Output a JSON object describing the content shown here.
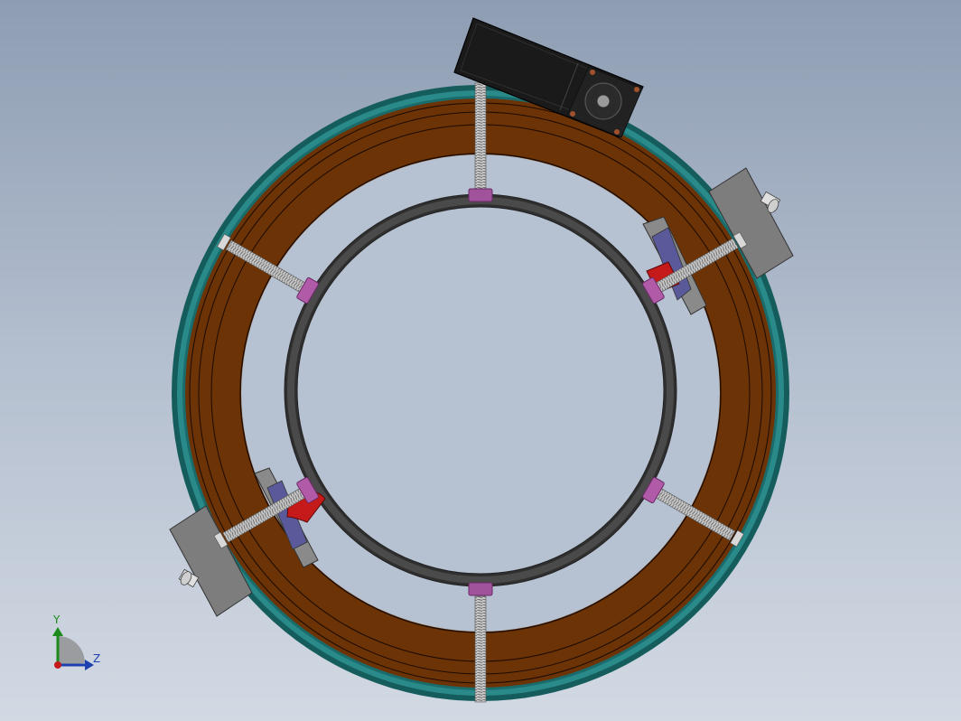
{
  "view": {
    "background_top": "#8e9db3",
    "background_bottom": "#d2d9e3"
  },
  "model": {
    "outer_shell_color": "#1f7a7a",
    "wood_ring_color": "#6b3306",
    "inner_ring_color": "#3c3c3c",
    "spacer_color": "#b05aa8",
    "screw_color": "#b8b8b8",
    "clamp_plate_color": "#7d7d7d",
    "bracket_color": "#c41a1a",
    "pad_color": "#5a5a9a",
    "motor_color": "#1a1a1a",
    "flange_color": "#5a3a2a"
  },
  "triad": {
    "y_label": "Y",
    "z_label": "Z",
    "y_color": "#1d8a1d",
    "z_color": "#1f3fb0",
    "x_color": "#c41a1a"
  }
}
